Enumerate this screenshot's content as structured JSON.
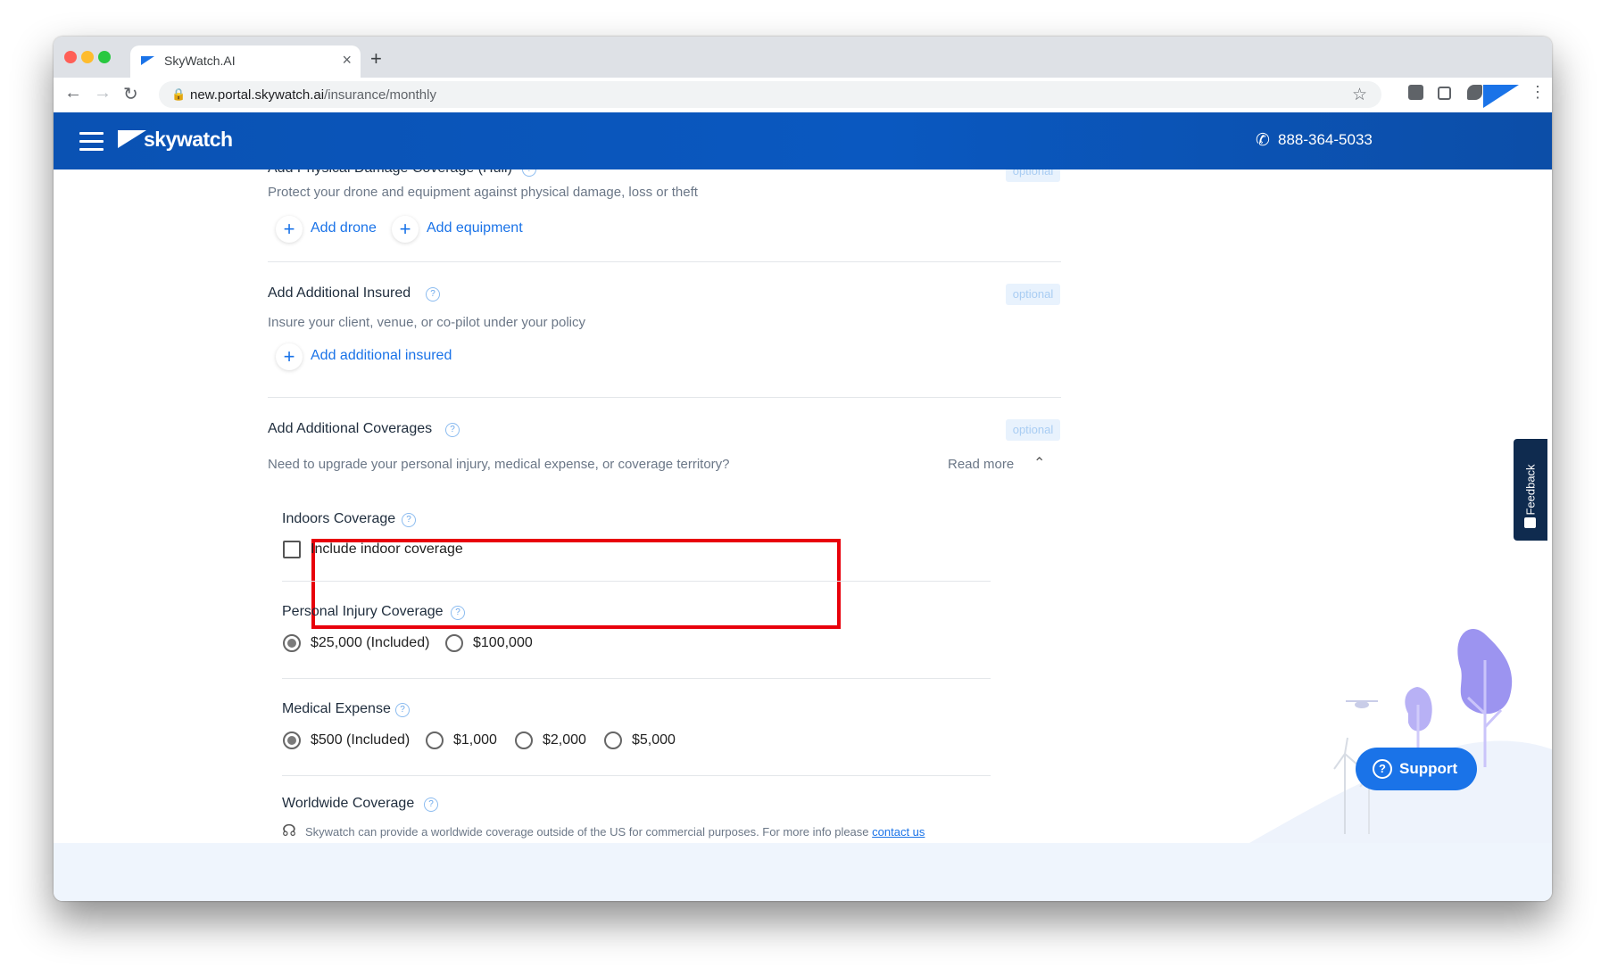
{
  "browser": {
    "tab_title": "SkyWatch.AI",
    "tab_close": "×",
    "new_tab": "+",
    "url_host": "new.portal.skywatch.ai",
    "url_path": "/insurance/monthly"
  },
  "header": {
    "brand": "skywatch",
    "phone": "888-364-5033"
  },
  "sections": {
    "hull": {
      "title": "Add Physical Damage Coverage (Hull)",
      "badge": "optional",
      "description": "Protect your drone and equipment against physical damage, loss or theft",
      "add_drone": "Add drone",
      "add_equipment": "Add equipment"
    },
    "additional_insured": {
      "title": "Add Additional Insured",
      "badge": "optional",
      "description": "Insure your client, venue, or co-pilot under your policy",
      "add_label": "Add additional insured"
    },
    "additional_coverages": {
      "title": "Add Additional Coverages",
      "badge": "optional",
      "description": "Need to upgrade your personal injury, medical expense, or coverage territory?",
      "read_more": "Read more"
    }
  },
  "indoors": {
    "title": "Indoors Coverage",
    "checkbox_label": "Include indoor coverage",
    "checked": false
  },
  "personal_injury": {
    "title": "Personal Injury Coverage",
    "options": [
      "$25,000 (Included)",
      "$100,000"
    ],
    "selected": "$25,000 (Included)"
  },
  "medical_expense": {
    "title": "Medical Expense",
    "options": [
      "$500 (Included)",
      "$1,000",
      "$2,000",
      "$5,000"
    ],
    "selected": "$500 (Included)"
  },
  "worldwide": {
    "title": "Worldwide Coverage",
    "text": "Skywatch can provide a worldwide coverage outside of the US for commercial purposes. For more info please",
    "link": "contact us"
  },
  "feedback_label": "Feedback",
  "support_label": "Support",
  "icons": {
    "help": "?",
    "plus": "+",
    "phone": "✆"
  },
  "colors": {
    "brand_blue": "#0a52b3",
    "link_blue": "#1a73e8",
    "highlight_red": "#e8000b"
  }
}
